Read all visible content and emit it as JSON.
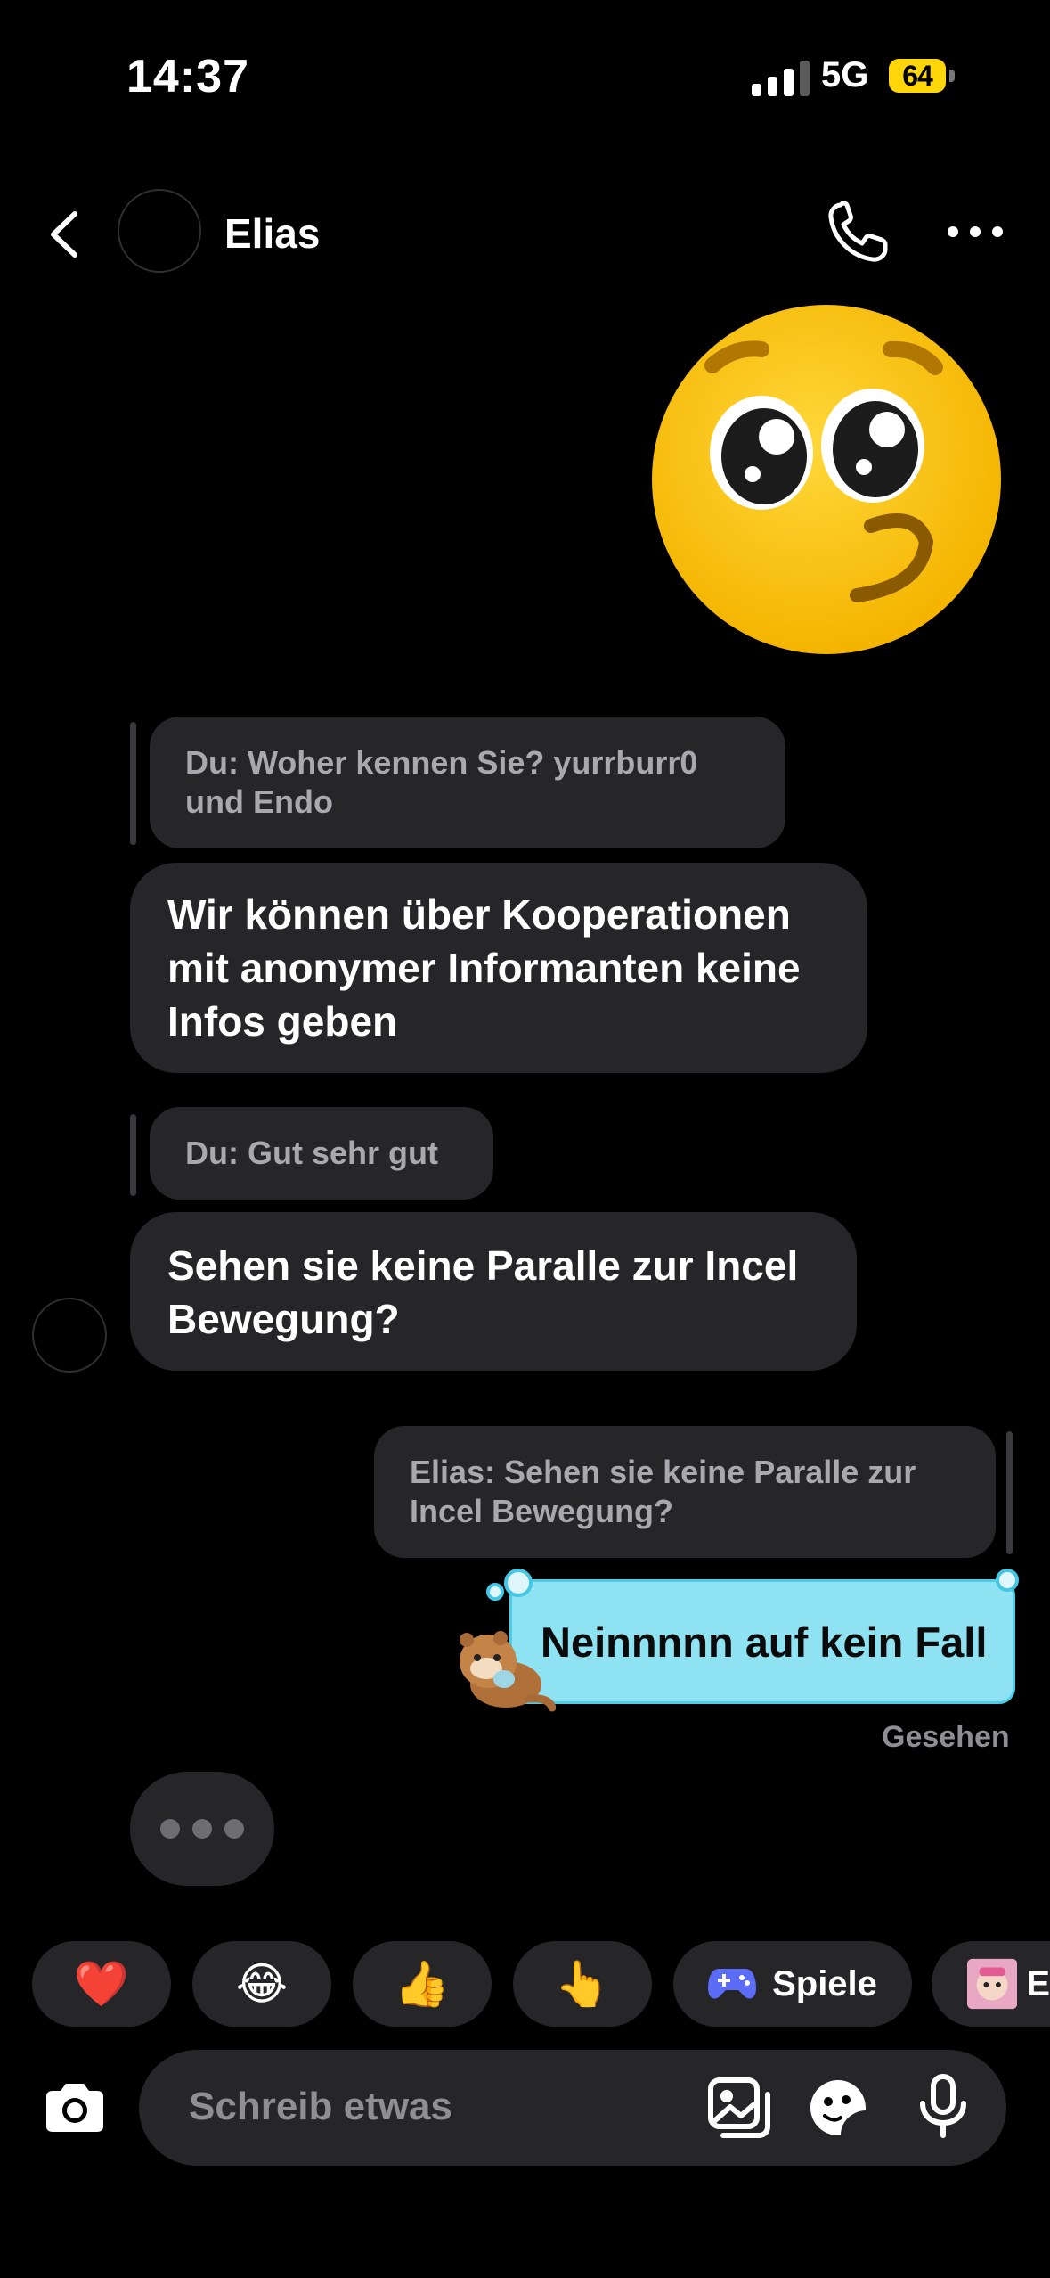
{
  "status_bar": {
    "time": "14:37",
    "network": "5G",
    "battery": "64"
  },
  "header": {
    "contact_name": "Elias"
  },
  "messages": [
    {
      "type": "reply_quote",
      "text_line1": "Du: Woher kennen Sie? yurrburr0",
      "text_line2": "und Endo"
    },
    {
      "type": "incoming",
      "lines": [
        "Wir können über Kooperationen",
        "mit anonymer Informanten keine",
        "Infos geben"
      ]
    },
    {
      "type": "reply_quote",
      "text": "Du: Gut sehr gut"
    },
    {
      "type": "incoming",
      "lines": [
        "Sehen sie keine Paralle zur Incel",
        "Bewegung?"
      ]
    },
    {
      "type": "reply_quote_outgoing",
      "text_line1": "Elias: Sehen sie keine Paralle zur",
      "text_line2": "Incel Bewegung?"
    },
    {
      "type": "outgoing_sticker_bubble",
      "text": "Neinnnnn auf kein Fall"
    }
  ],
  "seen_label": "Gesehen",
  "quick_replies": [
    {
      "icon": "heart-emoji",
      "glyph": "❤️"
    },
    {
      "icon": "laughing-emoji",
      "glyph": "😂"
    },
    {
      "icon": "thumbs-up-emoji",
      "glyph": "👍"
    },
    {
      "icon": "pointing-hand-emoji",
      "glyph": "👆"
    },
    {
      "icon": "gamepad-icon",
      "label": "Spiele"
    },
    {
      "icon": "sticker-thumbnail",
      "label": "E"
    }
  ],
  "composer": {
    "placeholder": "Schreib etwas"
  },
  "colors": {
    "bubble": "#262628",
    "sticker_bubble": "#8fe2f2",
    "accent_game": "#5b6cf6"
  }
}
